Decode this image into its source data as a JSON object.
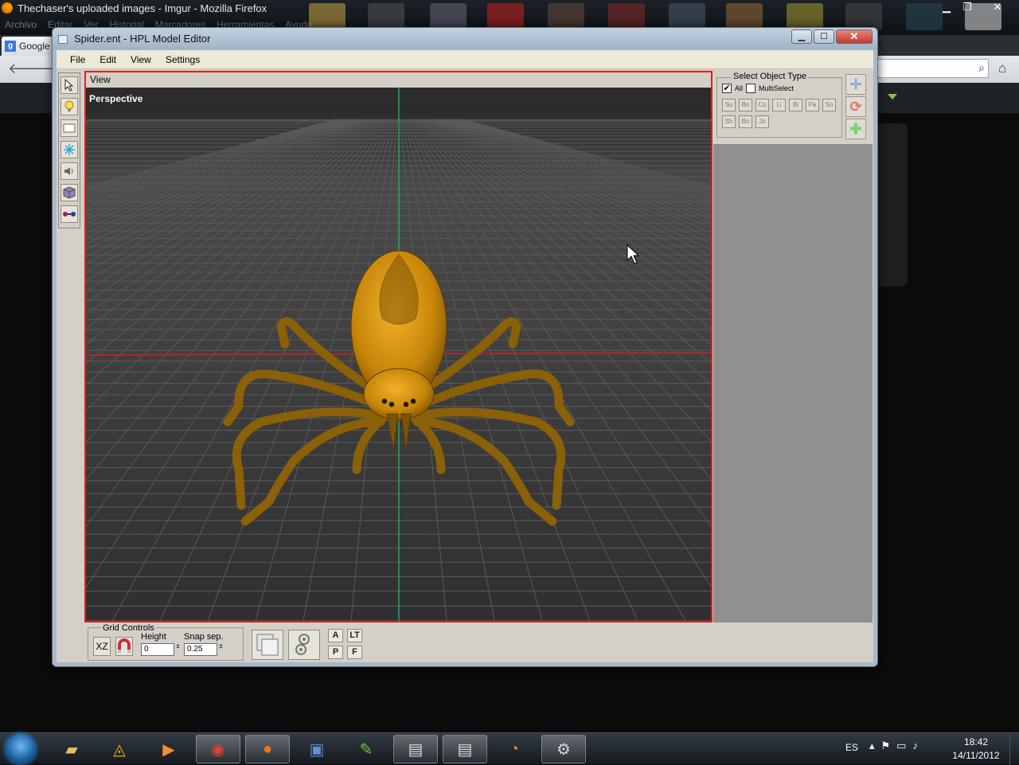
{
  "browser": {
    "title": "Thechaser's uploaded images - Imgur - Mozilla Firefox",
    "menu": [
      "Archivo",
      "Editar",
      "Ver",
      "Historial",
      "Marcadores",
      "Herramientas",
      "Ayuda"
    ],
    "tab_label": "Google",
    "tab_icon": "g"
  },
  "editor": {
    "title": "Spider.ent - HPL Model Editor",
    "menu": [
      "File",
      "Edit",
      "View",
      "Settings"
    ],
    "viewport": {
      "header": "View",
      "mode_label": "Perspective"
    },
    "select_object_type": {
      "title": "Select Object Type",
      "all_label": "All",
      "all_checked": true,
      "multiselect_label": "MultiSelect",
      "multiselect_checked": false,
      "types_row1": [
        "Su",
        "Bo",
        "Co",
        "Li",
        "Bi",
        "Pa",
        "So"
      ],
      "types_row2": [
        "Sh",
        "Bo",
        "Jo"
      ]
    },
    "grid_controls": {
      "title": "Grid Controls",
      "plane_label": "XZ",
      "height_label": "Height",
      "height_value": "0",
      "snap_label": "Snap sep.",
      "snap_value": "0.25"
    },
    "view_buttons": [
      "A",
      "LT",
      "P",
      "F"
    ],
    "colors": {
      "viewport_border": "#e02020",
      "spider": "#c8860a",
      "grid_axis_x": "#cc2222",
      "grid_axis_y": "#22aa55"
    }
  },
  "taskbar": {
    "language": "ES",
    "time": "18:42",
    "date": "14/11/2012"
  }
}
